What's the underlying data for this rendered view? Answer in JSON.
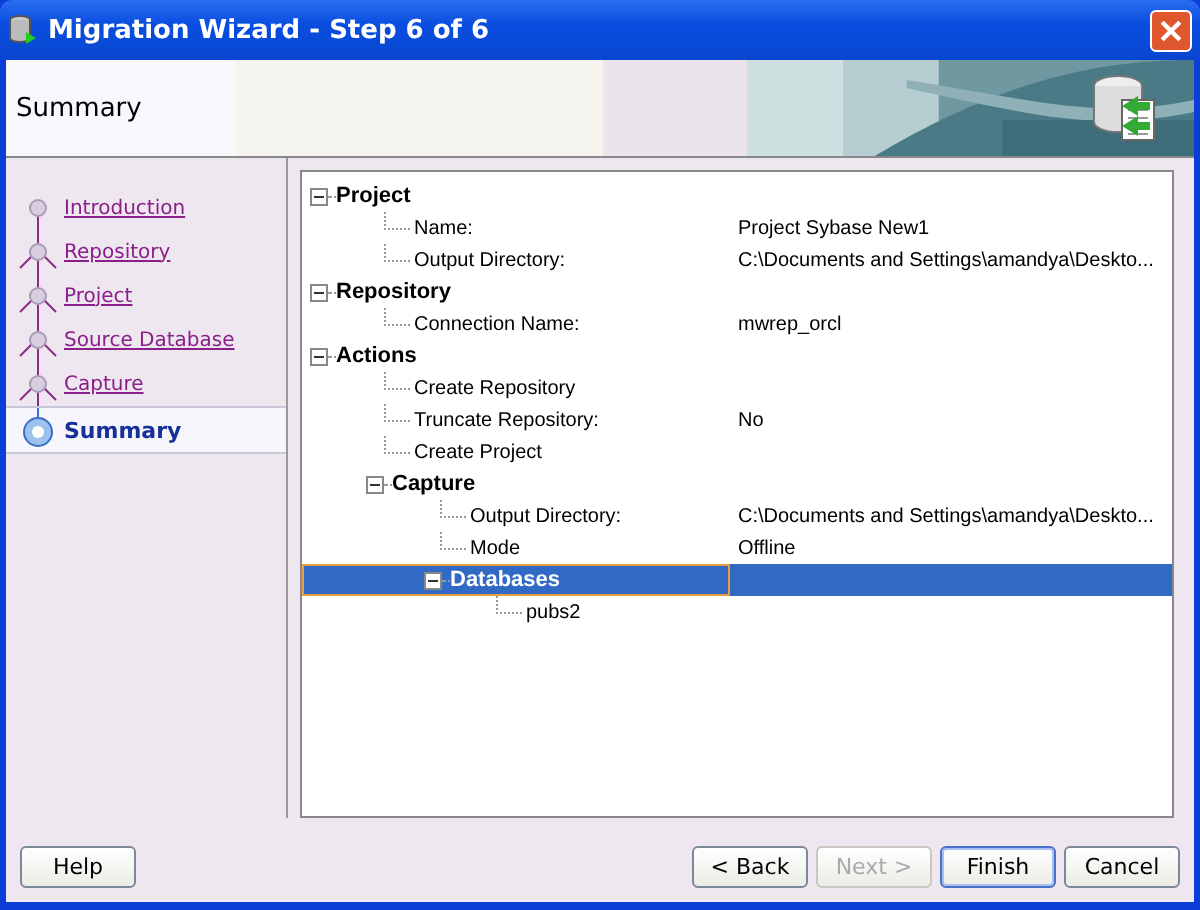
{
  "window": {
    "title": "Migration Wizard - Step 6 of 6"
  },
  "header": {
    "title": "Summary"
  },
  "steps": [
    {
      "label": "Introduction",
      "selected": false
    },
    {
      "label": "Repository",
      "selected": false
    },
    {
      "label": "Project",
      "selected": false
    },
    {
      "label": "Source Database",
      "selected": false
    },
    {
      "label": "Capture ",
      "selected": false
    },
    {
      "label": "Summary",
      "selected": true
    }
  ],
  "tree": [
    {
      "kind": "group",
      "label": "Project",
      "expanded": true,
      "selected": false,
      "children": [
        {
          "kind": "item",
          "label": "Name:",
          "value": "Project Sybase New1",
          "selected": false
        },
        {
          "kind": "item",
          "label": "Output Directory:",
          "value": "C:\\Documents and Settings\\amandya\\Deskto...",
          "selected": false
        }
      ]
    },
    {
      "kind": "group",
      "label": "Repository",
      "expanded": true,
      "selected": false,
      "children": [
        {
          "kind": "item",
          "label": "Connection Name:",
          "value": "mwrep_orcl",
          "selected": false
        }
      ]
    },
    {
      "kind": "group",
      "label": "Actions",
      "expanded": true,
      "selected": false,
      "children": [
        {
          "kind": "item",
          "label": "Create Repository",
          "selected": false
        },
        {
          "kind": "item",
          "label": "Truncate Repository:",
          "value": "No",
          "selected": false
        },
        {
          "kind": "item",
          "label": "Create Project",
          "selected": false
        },
        {
          "kind": "group",
          "label": "Capture",
          "expanded": true,
          "selected": false,
          "children": [
            {
              "kind": "item",
              "label": "Output Directory:",
              "value": "C:\\Documents and Settings\\amandya\\Deskto...",
              "selected": false
            },
            {
              "kind": "item",
              "label": "Mode",
              "value": "Offline",
              "selected": false
            },
            {
              "kind": "group",
              "label": "Databases",
              "expanded": true,
              "selected": true,
              "children": [
                {
                  "kind": "item",
                  "label": "pubs2",
                  "selected": false
                }
              ]
            }
          ]
        }
      ]
    }
  ],
  "buttons": [
    {
      "label": "Help",
      "disabled": false,
      "focused": false
    },
    {
      "label": "< Back",
      "disabled": false,
      "focused": false
    },
    {
      "label": "Next >",
      "disabled": true,
      "focused": false
    },
    {
      "label": "Finish",
      "disabled": false,
      "focused": true
    },
    {
      "label": "Cancel",
      "disabled": false,
      "focused": false
    }
  ]
}
